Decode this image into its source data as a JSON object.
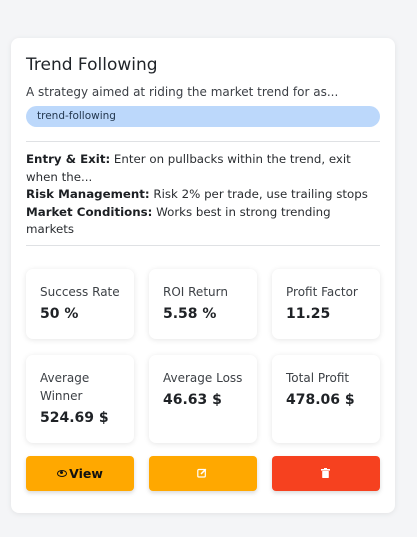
{
  "strategy": {
    "title": "Trend Following",
    "description": "A strategy aimed at riding the market trend for as...",
    "tag": "trend-following",
    "entry_exit_label": "Entry & Exit:",
    "entry_exit_text": " Enter on pullbacks within the trend, exit when the...",
    "risk_label": "Risk Management:",
    "risk_text": " Risk 2% per trade, use trailing stops",
    "conditions_label": "Market Conditions:",
    "conditions_text": " Works best in strong trending markets"
  },
  "stats": [
    {
      "label": "Success Rate",
      "value": "50 %"
    },
    {
      "label": "ROI Return",
      "value": "5.58 %"
    },
    {
      "label": "Profit Factor",
      "value": "11.25"
    },
    {
      "label": "Average Winner",
      "value": "524.69 $"
    },
    {
      "label": "Average Loss",
      "value": "46.63 $"
    },
    {
      "label": "Total Profit",
      "value": "478.06 $"
    }
  ],
  "actions": {
    "view_label": "View",
    "edit_icon": "edit-icon",
    "delete_icon": "trash-icon",
    "colors": {
      "view": "#ffa800",
      "edit": "#ffa800",
      "delete": "#f6411f"
    }
  },
  "colors": {
    "tag_bg": "#bcd8fb"
  }
}
